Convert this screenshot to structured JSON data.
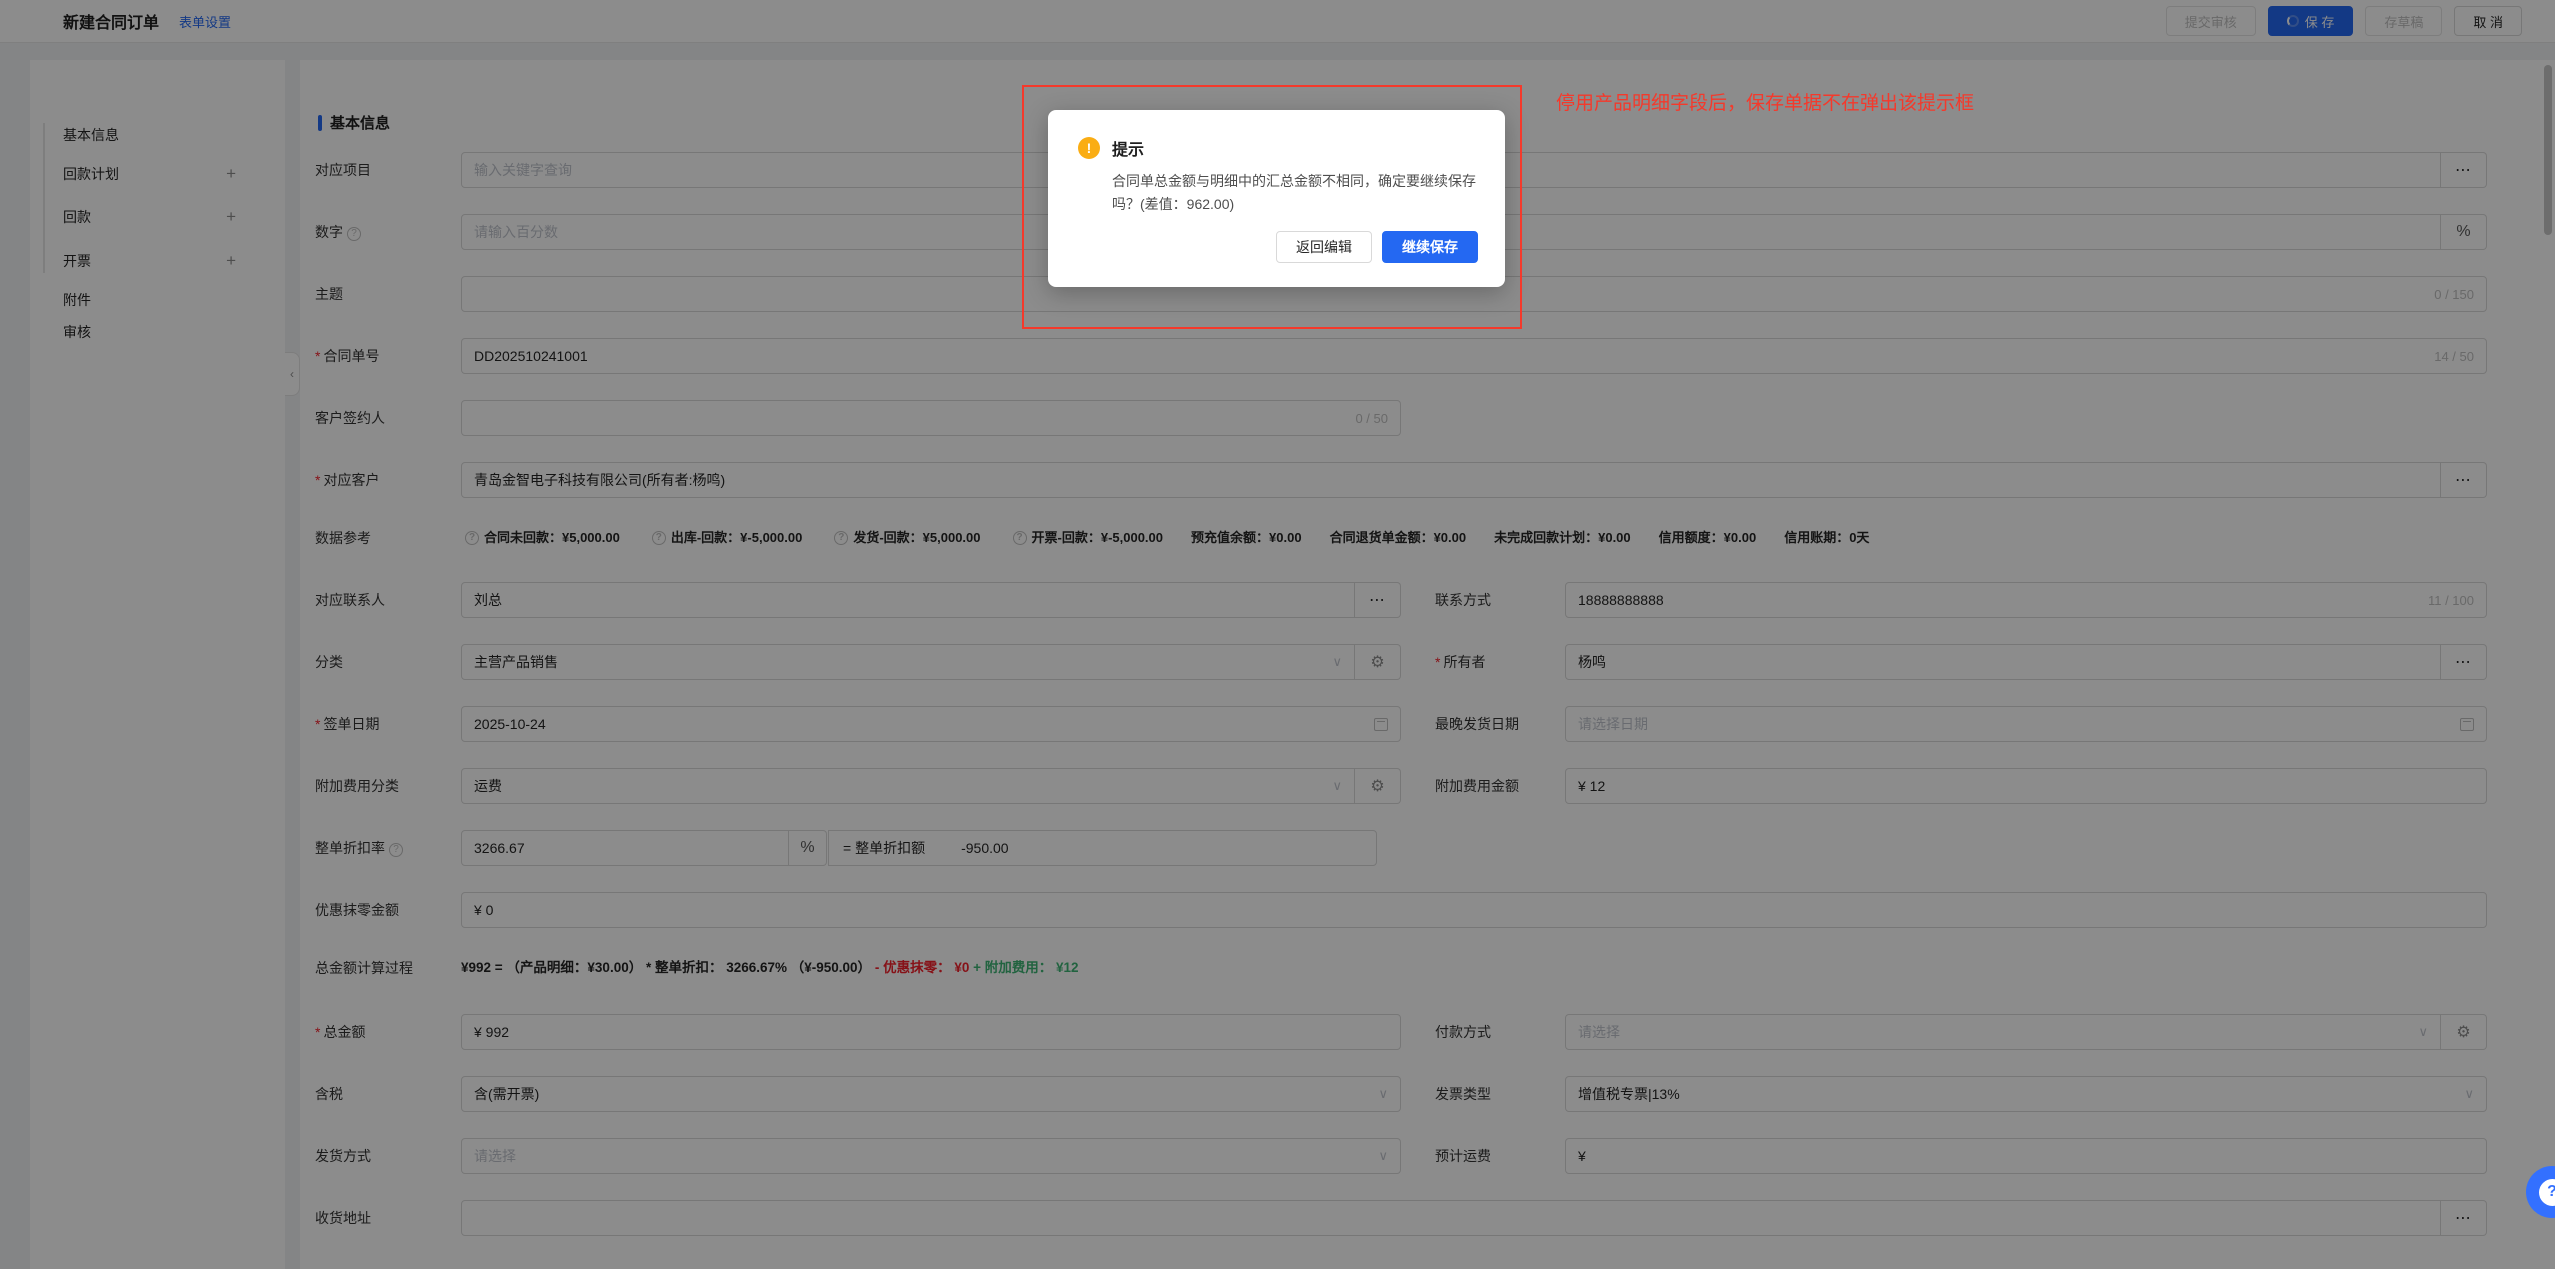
{
  "colors": {
    "primary": "#2468f2",
    "warning": "#faad14",
    "annotation_red": "#f5392b",
    "calc_red": "#f5222d",
    "calc_green": "#3eb575"
  },
  "icons": {
    "ellipsis": "⋯",
    "gear": "⚙",
    "chevron_down": "∨",
    "plus": "+",
    "question": "?",
    "exclamation": "!",
    "collapse": "‹"
  },
  "header": {
    "title": "新建合同订单",
    "form_settings_link": "表单设置",
    "buttons": {
      "submit_review": "提交审核",
      "save": "保 存",
      "save_draft": "存草稿",
      "cancel": "取 消"
    }
  },
  "sidebar": {
    "items": [
      {
        "label": "基本信息"
      },
      {
        "label": "回款计划"
      },
      {
        "label": "回款"
      },
      {
        "label": "开票"
      },
      {
        "label": "附件"
      },
      {
        "label": "审核"
      }
    ]
  },
  "form": {
    "section_title": "基本信息",
    "fields": {
      "project": {
        "label": "对应项目",
        "placeholder": "输入关键字查询"
      },
      "number": {
        "label": "数字",
        "placeholder": "请输入百分数",
        "suffix": "%"
      },
      "subject": {
        "label": "主题",
        "counter": "0 / 150"
      },
      "contract_no": {
        "label": "合同单号",
        "value": "DD202510241001",
        "counter": "14 / 50"
      },
      "customer_signer": {
        "label": "客户签约人",
        "counter": "0 / 50"
      },
      "customer": {
        "label": "对应客户",
        "value": "青岛金智电子科技有限公司(所有者:杨鸣)"
      },
      "contact": {
        "label": "对应联系人",
        "value": "刘总"
      },
      "contact_phone": {
        "label": "联系方式",
        "value": "18888888888",
        "counter": "11 / 100"
      },
      "category": {
        "label": "分类",
        "value": "主营产品销售"
      },
      "owner": {
        "label": "所有者",
        "value": "杨鸣"
      },
      "sign_date": {
        "label": "签单日期",
        "value": "2025-10-24"
      },
      "latest_ship_date": {
        "label": "最晚发货日期",
        "placeholder": "请选择日期"
      },
      "extra_fee_category": {
        "label": "附加费用分类",
        "value": "运费"
      },
      "extra_fee_amount": {
        "label": "附加费用金额",
        "value": "¥ 12"
      },
      "discount_rate": {
        "label": "整单折扣率",
        "value": "3266.67",
        "suffix": "%",
        "equals_label": "= 整单折扣额",
        "equals_value": "-950.00"
      },
      "rounding_amount": {
        "label": "优惠抹零金额",
        "value": "¥ 0"
      },
      "total_amount": {
        "label": "总金额",
        "value": "¥ 992"
      },
      "payment_method": {
        "label": "付款方式",
        "placeholder": "请选择"
      },
      "tax_included": {
        "label": "含税",
        "value": "含(需开票)"
      },
      "invoice_type": {
        "label": "发票类型",
        "value": "增值税专票|13%"
      },
      "shipping_method": {
        "label": "发货方式",
        "placeholder": "请选择"
      },
      "estimated_freight": {
        "label": "预计运费",
        "value": "¥"
      },
      "shipping_address": {
        "label": "收货地址"
      }
    },
    "data_reference": {
      "label": "数据参考",
      "items": [
        {
          "text": "合同未回款：¥5,000.00"
        },
        {
          "text": "出库-回款：¥-5,000.00"
        },
        {
          "text": "发货-回款：¥5,000.00"
        },
        {
          "text": "开票-回款：¥-5,000.00"
        },
        {
          "text": "预充值余额：¥0.00"
        },
        {
          "text": "合同退货单金额：¥0.00"
        },
        {
          "text": "未完成回款计划：¥0.00"
        },
        {
          "text": "信用额度：¥0.00"
        },
        {
          "text": "信用账期：0天"
        }
      ]
    },
    "calc": {
      "label": "总金额计算过程",
      "main": "¥992 = （产品明细：¥30.00） * 整单折扣： 3266.67% （¥-950.00）",
      "minus": "- 优惠抹零： ¥0",
      "plus": "+ 附加费用： ¥12"
    }
  },
  "modal": {
    "title": "提示",
    "message": "合同单总金额与明细中的汇总金额不相同，确定要继续保存吗？(差值：962.00)",
    "back_button": "返回编辑",
    "continue_button": "继续保存"
  },
  "annotation": {
    "note": "停用产品明细字段后，保存单据不在弹出该提示框"
  }
}
